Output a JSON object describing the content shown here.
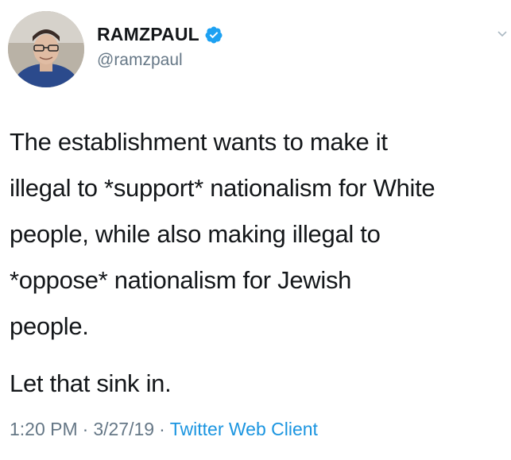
{
  "author": {
    "display_name": "RAMZPAUL",
    "handle": "@ramzpaul",
    "verified": true,
    "avatar_icon": "user-avatar-photo"
  },
  "tweet": {
    "lines": [
      "The establishment wants to make it",
      "illegal to *support* nationalism for White",
      "people, while also making illegal to",
      "*oppose* nationalism for Jewish",
      "people."
    ],
    "closing": "Let that sink in."
  },
  "meta": {
    "time": "1:20 PM",
    "separator": "·",
    "date": "3/27/19",
    "client": "Twitter Web Client"
  },
  "colors": {
    "text": "#14171a",
    "secondary": "#657786",
    "link": "#1b95e0",
    "verified": "#1da1f2"
  }
}
